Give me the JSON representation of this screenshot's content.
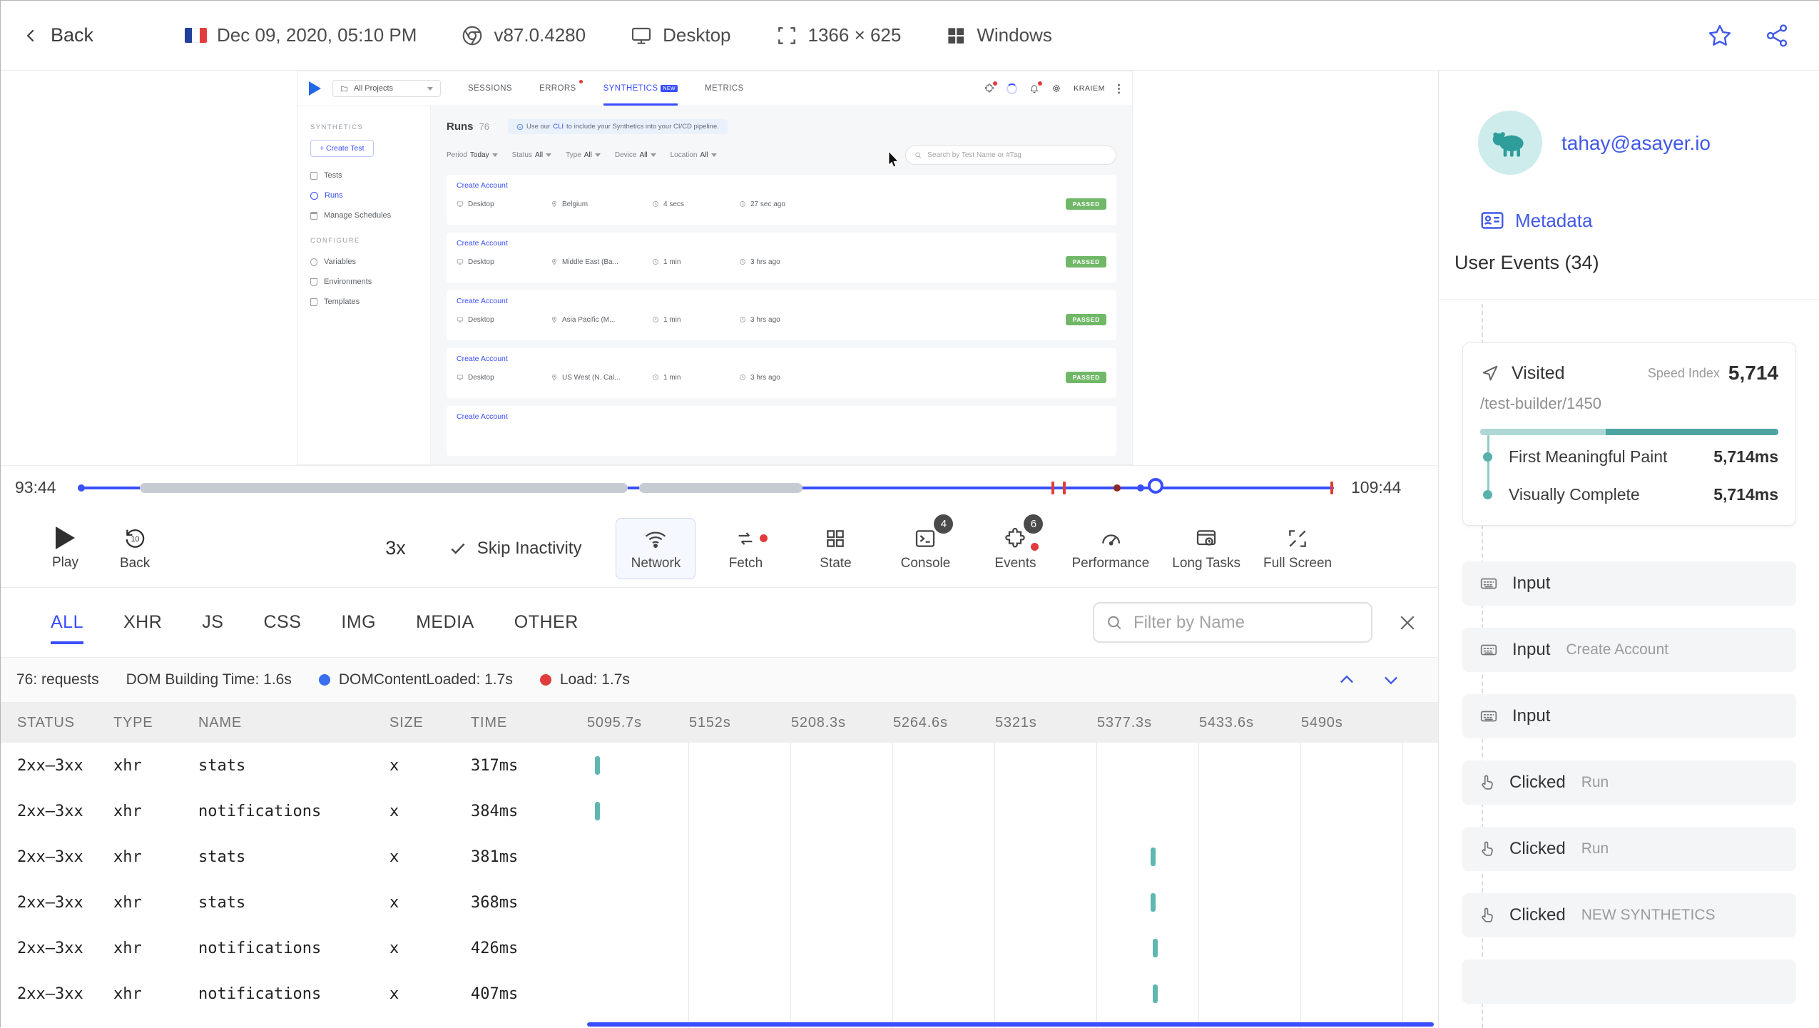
{
  "colors": {
    "accent": "#394eff",
    "teal": "#55b0ab",
    "green_badge": "#70b868",
    "red_marker": "#e03c3c"
  },
  "topbar": {
    "back_label": "Back",
    "date": "Dec 09, 2020, 05:10 PM",
    "browser_version": "v87.0.4280",
    "device": "Desktop",
    "resolution": "1366 × 625",
    "os": "Windows"
  },
  "replay": {
    "nav": {
      "project_selector": "All Projects",
      "tabs": [
        "SESSIONS",
        "ERRORS",
        "SYNTHETICS",
        "METRICS"
      ],
      "new_badge": "NEW",
      "user": "KRAIEM"
    },
    "side": {
      "section1": "SYNTHETICS",
      "create_test": "+ Create Test",
      "items1": [
        {
          "label": "Tests",
          "icon": "doc"
        },
        {
          "label": "Runs",
          "icon": "clock",
          "active": true
        },
        {
          "label": "Manage Schedules",
          "icon": "cal"
        }
      ],
      "section2": "CONFIGURE",
      "items2": [
        {
          "label": "Variables",
          "icon": "var"
        },
        {
          "label": "Environments",
          "icon": "env"
        },
        {
          "label": "Templates",
          "icon": "tpl"
        }
      ]
    },
    "main": {
      "title": "Runs",
      "count": "76",
      "banner_pre": "Use our",
      "banner_link": "CLI",
      "banner_post": "to include your Synthetics into your CI/CD pipeline.",
      "filters": [
        {
          "label": "Period",
          "value": "Today"
        },
        {
          "label": "Status",
          "value": "All"
        },
        {
          "label": "Type",
          "value": "All"
        },
        {
          "label": "Device",
          "value": "All"
        },
        {
          "label": "Location",
          "value": "All"
        }
      ],
      "search_placeholder": "Search by Test Name or #Tag",
      "runs": [
        {
          "name": "Create Account",
          "device": "Desktop",
          "location": "Belgium",
          "duration": "4 secs",
          "ago": "27 sec ago",
          "status": "PASSED"
        },
        {
          "name": "Create Account",
          "device": "Desktop",
          "location": "Middle East (Ba...",
          "duration": "1 min",
          "ago": "3 hrs ago",
          "status": "PASSED"
        },
        {
          "name": "Create Account",
          "device": "Desktop",
          "location": "Asia Pacific (M...",
          "duration": "1 min",
          "ago": "3 hrs ago",
          "status": "PASSED"
        },
        {
          "name": "Create Account",
          "device": "Desktop",
          "location": "US West (N. Cal...",
          "duration": "1 min",
          "ago": "3 hrs ago",
          "status": "PASSED"
        },
        {
          "name": "Create Account"
        }
      ]
    }
  },
  "timeline": {
    "current": "93:44",
    "total": "109:44",
    "knob_pct": 85.8,
    "inactivity": [
      {
        "left": 4.8,
        "width": 38.9
      },
      {
        "left": 44.6,
        "width": 13.0
      }
    ],
    "markers": [
      {
        "kind": "tick",
        "pos": 77.5
      },
      {
        "kind": "tick",
        "pos": 78.4
      },
      {
        "kind": "dot-dark",
        "pos": 82.4
      },
      {
        "kind": "dot-blue",
        "pos": 84.3
      },
      {
        "kind": "tick",
        "pos": 99.7
      }
    ]
  },
  "controls": {
    "play": "Play",
    "back": "Back",
    "back_amount": "10",
    "speed": "3x",
    "skip": "Skip Inactivity",
    "buttons": [
      {
        "label": "Network",
        "active": true
      },
      {
        "label": "Fetch",
        "alert": true
      },
      {
        "label": "State"
      },
      {
        "label": "Console",
        "badge": "4"
      },
      {
        "label": "Events",
        "badge": "6",
        "alert": true
      },
      {
        "label": "Performance"
      },
      {
        "label": "Long Tasks"
      },
      {
        "label": "Full Screen"
      }
    ]
  },
  "network": {
    "tabs": [
      {
        "label": "ALL",
        "active": true
      },
      {
        "label": "XHR"
      },
      {
        "label": "JS"
      },
      {
        "label": "CSS"
      },
      {
        "label": "IMG"
      },
      {
        "label": "MEDIA"
      },
      {
        "label": "OTHER"
      }
    ],
    "filter_placeholder": "Filter by Name",
    "stats": {
      "requests": "76: requests",
      "dom": "DOM Building Time: 1.6s",
      "dcl": "DOMContentLoaded: 1.7s",
      "load": "Load: 1.7s"
    },
    "columns": [
      "STATUS",
      "TYPE",
      "NAME",
      "SIZE",
      "TIME"
    ],
    "time_columns": [
      "5095.7s",
      "5152s",
      "5208.3s",
      "5264.6s",
      "5321s",
      "5377.3s",
      "5433.6s",
      "5490s"
    ],
    "rows": [
      {
        "status": "2xx–3xx",
        "type": "xhr",
        "name": "stats",
        "size": "x",
        "time": "317ms",
        "bar_left_pct": 0.9
      },
      {
        "status": "2xx–3xx",
        "type": "xhr",
        "name": "notifications",
        "size": "x",
        "time": "384ms",
        "bar_left_pct": 0.9
      },
      {
        "status": "2xx–3xx",
        "type": "xhr",
        "name": "stats",
        "size": "x",
        "time": "381ms",
        "bar_left_pct": 66.4
      },
      {
        "status": "2xx–3xx",
        "type": "xhr",
        "name": "stats",
        "size": "x",
        "time": "368ms",
        "bar_left_pct": 66.4
      },
      {
        "status": "2xx–3xx",
        "type": "xhr",
        "name": "notifications",
        "size": "x",
        "time": "426ms",
        "bar_left_pct": 66.6
      },
      {
        "status": "2xx–3xx",
        "type": "xhr",
        "name": "notifications",
        "size": "x",
        "time": "407ms",
        "bar_left_pct": 66.6
      }
    ]
  },
  "user_panel": {
    "email": "tahay@asayer.io",
    "metadata_label": "Metadata",
    "heading": "User Events (34)",
    "visited": {
      "label": "Visited",
      "speed_index_label": "Speed Index",
      "speed_index": "5,714",
      "url": "/test-builder/1450",
      "metrics": [
        {
          "label": "First Meaningful Paint",
          "value": "5,714ms"
        },
        {
          "label": "Visually Complete",
          "value": "5,714ms"
        }
      ]
    },
    "events": [
      {
        "label": "Input",
        "detail": "",
        "is_input": true
      },
      {
        "label": "Input",
        "detail": "Create Account",
        "is_input": true
      },
      {
        "label": "Input",
        "detail": "",
        "is_input": true
      },
      {
        "label": "Clicked",
        "detail": "Run",
        "is_click": true
      },
      {
        "label": "Clicked",
        "detail": "Run",
        "is_click": true
      },
      {
        "label": "Clicked",
        "detail": "NEW SYNTHETICS",
        "is_click": true
      }
    ]
  }
}
